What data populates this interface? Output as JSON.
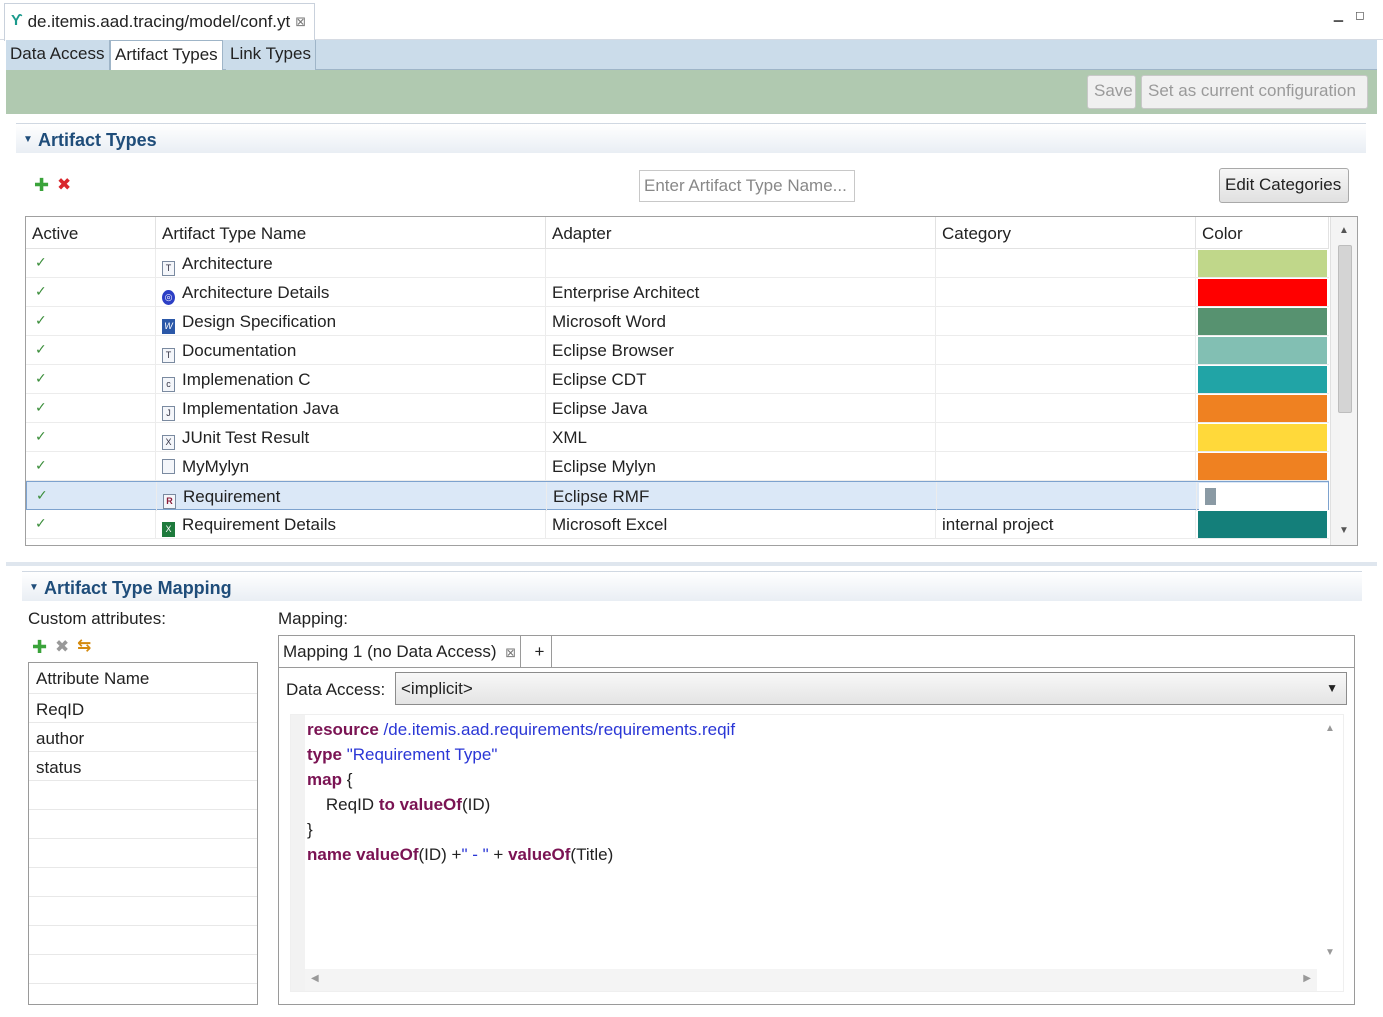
{
  "editor": {
    "tab_title": "de.itemis.aad.tracing/model/conf.yt",
    "close_glyph": "⊠",
    "minimize_glyph": "▁",
    "maximize_glyph": "◻"
  },
  "page_tabs": [
    {
      "label": "Data Access",
      "active": false
    },
    {
      "label": "Artifact Types",
      "active": true
    },
    {
      "label": "Link Types",
      "active": false
    }
  ],
  "toolbar": {
    "save_label": "Save",
    "set_current_label": "Set as current configuration"
  },
  "artifact_types": {
    "section_title": "Artifact Types",
    "search_placeholder": "Enter Artifact Type Name...",
    "edit_categories_label": "Edit Categories",
    "columns": [
      "Active",
      "Artifact Type Name",
      "Adapter",
      "Category",
      "Color"
    ],
    "rows": [
      {
        "active": "✓",
        "icon": "T",
        "name": "Architecture",
        "adapter": "",
        "category": "",
        "color": "#c0d78a"
      },
      {
        "active": "✓",
        "icon": "◎",
        "name": "Architecture Details",
        "adapter": "Enterprise Architect",
        "category": "",
        "color": "#ff0000"
      },
      {
        "active": "✓",
        "icon": "W",
        "name": "Design Specification",
        "adapter": "Microsoft Word",
        "category": "",
        "color": "#579270"
      },
      {
        "active": "✓",
        "icon": "T",
        "name": "Documentation",
        "adapter": "Eclipse Browser",
        "category": "",
        "color": "#82bfb3"
      },
      {
        "active": "✓",
        "icon": "c",
        "name": "Implemenation C",
        "adapter": "Eclipse CDT",
        "category": "",
        "color": "#21a4a6"
      },
      {
        "active": "✓",
        "icon": "J",
        "name": "Implementation Java",
        "adapter": "Eclipse Java",
        "category": "",
        "color": "#ef8121"
      },
      {
        "active": "✓",
        "icon": "X",
        "name": "JUnit Test Result",
        "adapter": "XML",
        "category": "",
        "color": "#ffd93a"
      },
      {
        "active": "✓",
        "icon": "",
        "name": "MyMylyn",
        "adapter": "Eclipse Mylyn",
        "category": "",
        "color": "#ef8121"
      },
      {
        "active": "✓",
        "icon": "R",
        "name": "Requirement",
        "adapter": "Eclipse RMF",
        "category": "",
        "color": ""
      },
      {
        "active": "✓",
        "icon": "X",
        "name": "Requirement Details",
        "adapter": "Microsoft Excel",
        "category": "internal project",
        "color": "#147f7a"
      }
    ]
  },
  "mapping_section": {
    "section_title": "Artifact Type Mapping",
    "custom_attributes_label": "Custom attributes:",
    "attribute_header": "Attribute Name",
    "attributes": [
      "ReqID",
      "author",
      "status"
    ],
    "mapping_label": "Mapping:",
    "mapping_tab_label": "Mapping 1 (no Data Access)",
    "add_tab_label": "+",
    "data_access_label": "Data Access:",
    "data_access_value": "<implicit>",
    "code": {
      "l1_kw": "resource",
      "l1_val": " /de.itemis.aad.requirements/requirements.reqif",
      "l2_kw": "type",
      "l2_val": " \"Requirement Type\"",
      "l3_kw": "map",
      "l3_rest": " {",
      "l4_a": "    ReqID ",
      "l4_kw1": "to",
      "l4_kw2": " valueOf",
      "l4_b": "(ID)",
      "l5": "}",
      "l6_kw1": "name",
      "l6_kw2": " valueOf",
      "l6_a": "(ID) +",
      "l6_str": "\" - \"",
      "l6_b": " + ",
      "l6_kw3": "valueOf",
      "l6_c": "(Title)"
    }
  }
}
